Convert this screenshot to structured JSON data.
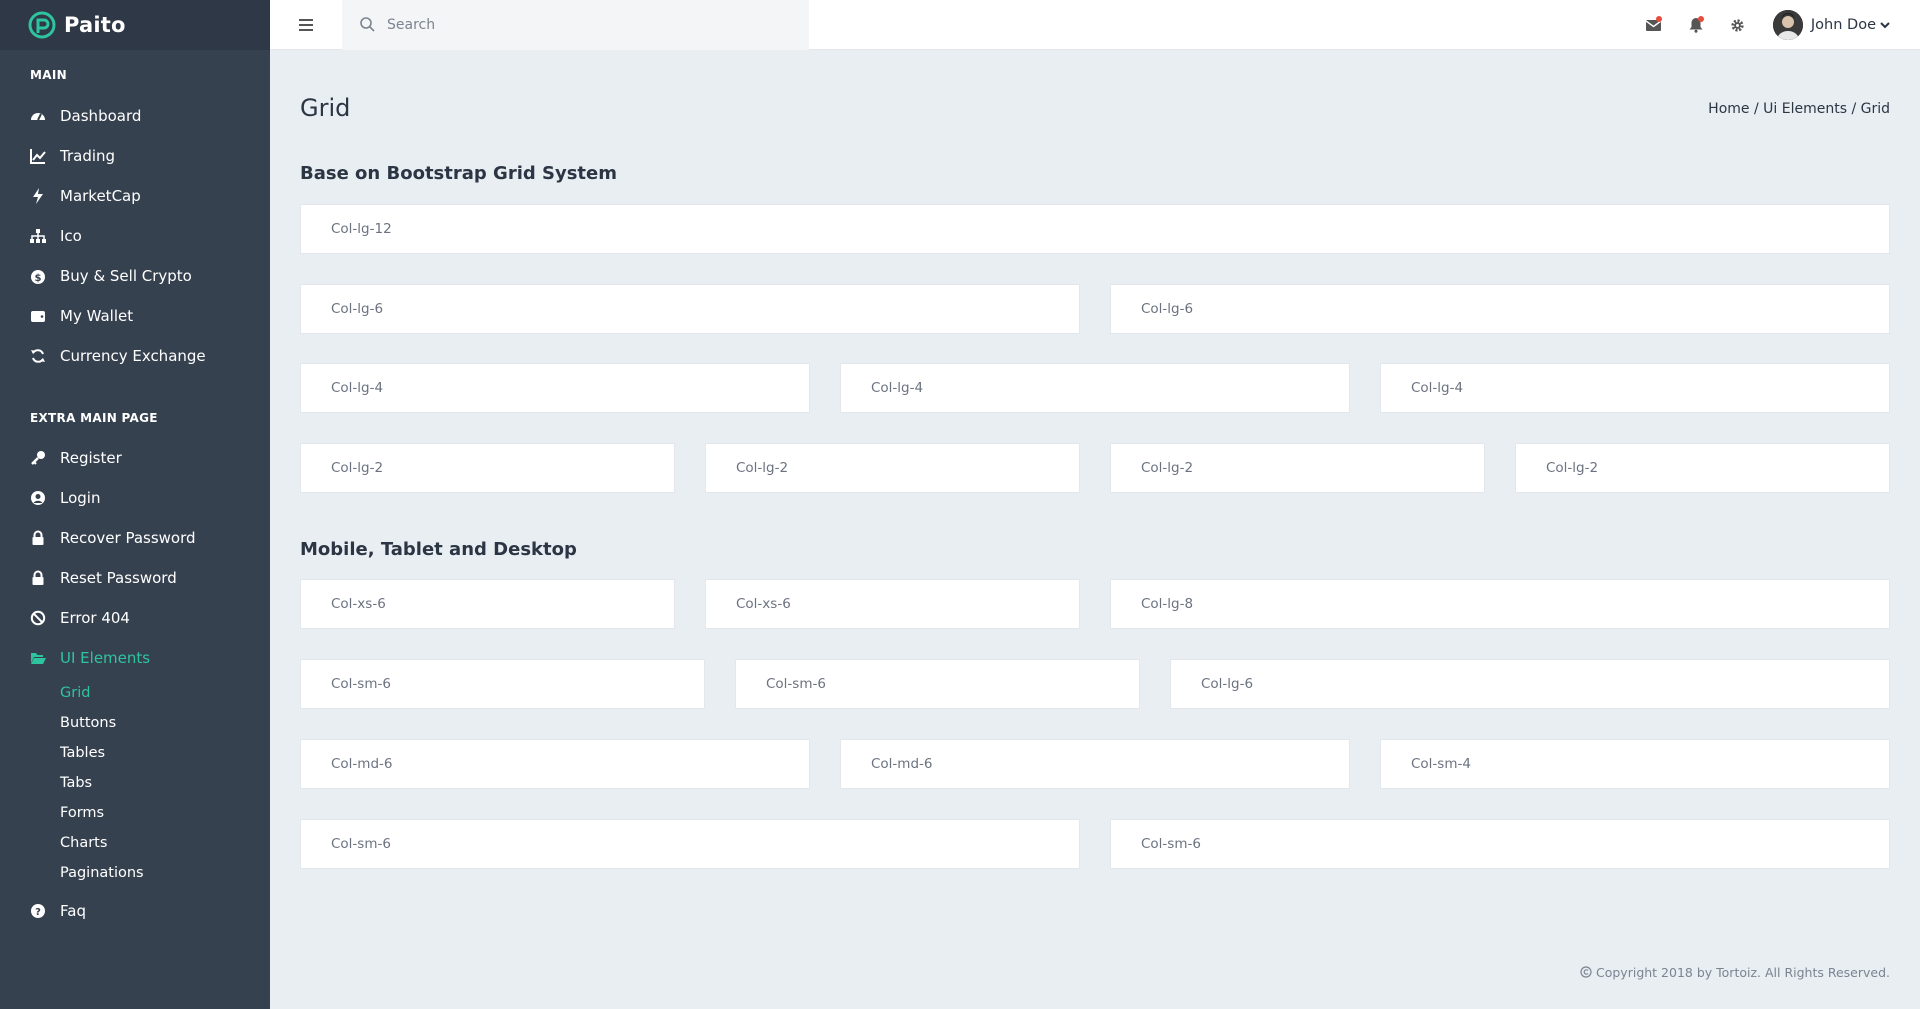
{
  "brand": {
    "name": "Paito",
    "accent_color": "#2ec4a0"
  },
  "sidebar": {
    "sections": [
      {
        "title": "MAIN"
      },
      {
        "title": "EXTRA MAIN PAGE"
      }
    ],
    "main_items": [
      {
        "label": "Dashboard",
        "icon": "dashboard-icon"
      },
      {
        "label": "Trading",
        "icon": "line-chart-icon"
      },
      {
        "label": "MarketCap",
        "icon": "bolt-icon"
      },
      {
        "label": "Ico",
        "icon": "sitemap-icon"
      },
      {
        "label": "Buy & Sell Crypto",
        "icon": "money-bag-icon"
      },
      {
        "label": "My Wallet",
        "icon": "wallet-icon"
      },
      {
        "label": "Currency Exchange",
        "icon": "refresh-icon"
      }
    ],
    "extra_items": [
      {
        "label": "Register",
        "icon": "key-icon"
      },
      {
        "label": "Login",
        "icon": "user-circle-icon"
      },
      {
        "label": "Recover Password",
        "icon": "lock-icon"
      },
      {
        "label": "Reset Password",
        "icon": "lock-icon"
      },
      {
        "label": "Error 404",
        "icon": "ban-icon"
      },
      {
        "label": "UI Elements",
        "icon": "folder-open-icon",
        "active": true
      }
    ],
    "ui_sub_items": [
      {
        "label": "Grid",
        "active": true
      },
      {
        "label": "Buttons"
      },
      {
        "label": "Tables"
      },
      {
        "label": "Tabs"
      },
      {
        "label": "Forms"
      },
      {
        "label": "Charts"
      },
      {
        "label": "Paginations"
      }
    ],
    "faq": {
      "label": "Faq",
      "icon": "question-circle-icon"
    }
  },
  "topbar": {
    "search_placeholder": "Search",
    "icons": [
      "mail-icon",
      "bell-icon",
      "gear-icon"
    ],
    "user_name": "John Doe"
  },
  "page": {
    "title": "Grid",
    "breadcrumb": [
      "Home",
      "Ui Elements",
      "Grid"
    ],
    "breadcrumb_separator": "/"
  },
  "sections": [
    {
      "heading": "Base on Bootstrap Grid System",
      "rows": [
        [
          "Col-lg-12"
        ],
        [
          "Col-lg-6",
          "Col-lg-6"
        ],
        [
          "Col-lg-4",
          "Col-lg-4",
          "Col-lg-4"
        ],
        [
          "Col-lg-2",
          "Col-lg-2",
          "Col-lg-2",
          "Col-lg-2"
        ]
      ]
    },
    {
      "heading": "Mobile, Tablet and Desktop",
      "rows": [
        [
          "Col-xs-6",
          "Col-xs-6",
          "Col-lg-8"
        ],
        [
          "Col-sm-6",
          "Col-sm-6",
          "Col-lg-6"
        ],
        [
          "Col-md-6",
          "Col-md-6",
          "Col-sm-4"
        ],
        [
          "Col-sm-6",
          "Col-sm-6"
        ]
      ]
    }
  ],
  "footer": {
    "text": "Copyright 2018 by Tortoiz. All Rights Reserved."
  }
}
